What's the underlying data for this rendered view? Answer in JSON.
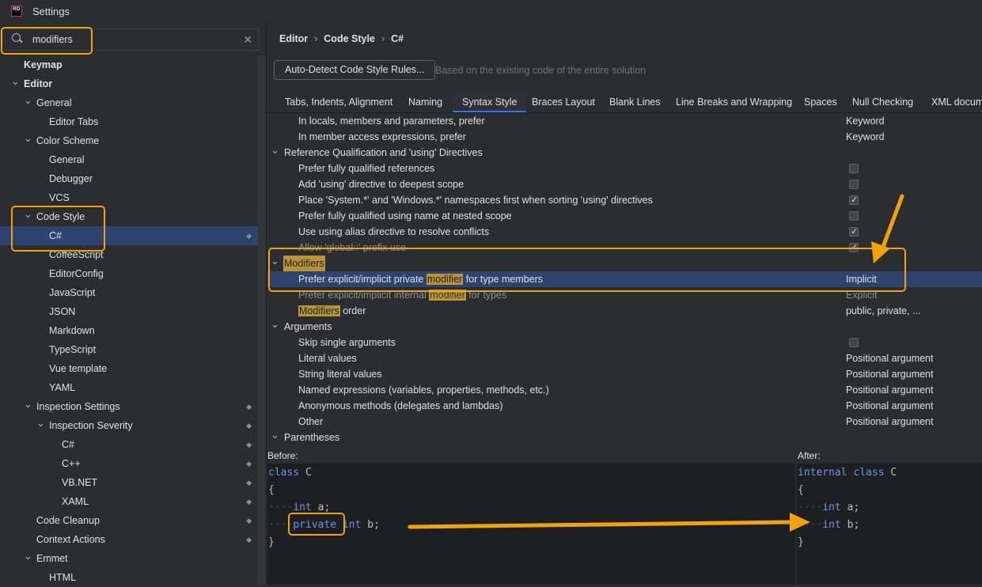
{
  "app": {
    "logo": "RD",
    "title": "Settings"
  },
  "search": {
    "value": "modifiers",
    "placeholder": ""
  },
  "tree": [
    {
      "label": "Keymap",
      "level": 0,
      "bold": true,
      "chev": ""
    },
    {
      "label": "Editor",
      "level": 0,
      "bold": true,
      "chev": "v"
    },
    {
      "label": "General",
      "level": 1,
      "chev": "v"
    },
    {
      "label": "Editor Tabs",
      "level": 2,
      "chev": ""
    },
    {
      "label": "Color Scheme",
      "level": 1,
      "chev": "v"
    },
    {
      "label": "General",
      "level": 2,
      "chev": ""
    },
    {
      "label": "Debugger",
      "level": 2,
      "chev": ""
    },
    {
      "label": "VCS",
      "level": 2,
      "chev": ""
    },
    {
      "label": "Code Style",
      "level": 1,
      "chev": "v"
    },
    {
      "label": "C#",
      "level": 2,
      "chev": "",
      "selected": true,
      "sc": true
    },
    {
      "label": "CoffeeScript",
      "level": 2,
      "chev": ""
    },
    {
      "label": "EditorConfig",
      "level": 2,
      "chev": ""
    },
    {
      "label": "JavaScript",
      "level": 2,
      "chev": ""
    },
    {
      "label": "JSON",
      "level": 2,
      "chev": ""
    },
    {
      "label": "Markdown",
      "level": 2,
      "chev": ""
    },
    {
      "label": "TypeScript",
      "level": 2,
      "chev": ""
    },
    {
      "label": "Vue template",
      "level": 2,
      "chev": ""
    },
    {
      "label": "YAML",
      "level": 2,
      "chev": ""
    },
    {
      "label": "Inspection Settings",
      "level": 1,
      "chev": "v",
      "sc": true
    },
    {
      "label": "Inspection Severity",
      "level": 2,
      "chev": "v",
      "sc": true
    },
    {
      "label": "C#",
      "level": 3,
      "chev": "",
      "sc": true
    },
    {
      "label": "C++",
      "level": 3,
      "chev": "",
      "sc": true
    },
    {
      "label": "VB.NET",
      "level": 3,
      "chev": "",
      "sc": true
    },
    {
      "label": "XAML",
      "level": 3,
      "chev": "",
      "sc": true
    },
    {
      "label": "Code Cleanup",
      "level": 1,
      "chev": "",
      "sc": true
    },
    {
      "label": "Context Actions",
      "level": 1,
      "chev": "",
      "sc": true
    },
    {
      "label": "Emmet",
      "level": 1,
      "chev": "v"
    },
    {
      "label": "HTML",
      "level": 2,
      "chev": ""
    }
  ],
  "breadcrumb": [
    "Editor",
    "Code Style",
    "C#"
  ],
  "auto_detect": {
    "button": "Auto-Detect Code Style Rules...",
    "hint": "Based on the existing code of the entire solution"
  },
  "tabs": [
    "Tabs, Indents, Alignment",
    "Naming",
    "Syntax Style",
    "Braces Layout",
    "Blank Lines",
    "Line Breaks and Wrapping",
    "Spaces",
    "Null Checking",
    "XML docum"
  ],
  "active_tab": "Syntax Style",
  "rows": [
    {
      "type": "item",
      "label": "In locals, members and parameters, prefer",
      "value": "Keyword"
    },
    {
      "type": "item",
      "label": "In member access expressions, prefer",
      "value": "Keyword"
    },
    {
      "type": "group",
      "label": "Reference Qualification and 'using' Directives"
    },
    {
      "type": "item",
      "label": "Prefer fully qualified references",
      "checkbox": false
    },
    {
      "type": "item",
      "label": "Add 'using' directive to deepest scope",
      "checkbox": false
    },
    {
      "type": "item",
      "label": "Place 'System.*' and 'Windows.*' namespaces first when sorting 'using' directives",
      "checkbox": true
    },
    {
      "type": "item",
      "label": "Prefer fully qualified using name at nested scope",
      "checkbox": false
    },
    {
      "type": "item",
      "label": "Use using alias directive to resolve conflicts",
      "checkbox": true
    },
    {
      "type": "item",
      "label": "Allow 'global::' prefix use",
      "checkbox": true,
      "dim": true
    },
    {
      "type": "group",
      "label": "Modifiers",
      "highlight": true
    },
    {
      "type": "item",
      "pre": "Prefer explicit/implicit private ",
      "hl": "modifier",
      "post": " for type members",
      "value": "Implicit",
      "selected": true
    },
    {
      "type": "item",
      "pre": "Prefer explicit/implicit internal ",
      "hl": "modifier",
      "post": " for types",
      "value": "Explicit",
      "dim": true
    },
    {
      "type": "item",
      "pre": "",
      "hl": "Modifiers",
      "post": " order",
      "value": "public, private, ..."
    },
    {
      "type": "group",
      "label": "Arguments"
    },
    {
      "type": "item",
      "label": "Skip single arguments",
      "checkbox": false
    },
    {
      "type": "item",
      "label": "Literal values",
      "value": "Positional argument"
    },
    {
      "type": "item",
      "label": "String literal values",
      "value": "Positional argument"
    },
    {
      "type": "item",
      "label": "Named expressions (variables, properties, methods, etc.)",
      "value": "Positional argument"
    },
    {
      "type": "item",
      "label": "Anonymous methods (delegates and lambdas)",
      "value": "Positional argument"
    },
    {
      "type": "item",
      "label": "Other",
      "value": "Positional argument"
    },
    {
      "type": "group",
      "label": "Parentheses"
    }
  ],
  "preview": {
    "before_label": "Before:",
    "after_label": "After:",
    "before_code": [
      [
        {
          "t": "class",
          "k": true
        },
        {
          "t": " C"
        }
      ],
      [
        {
          "t": "{"
        }
      ],
      [
        {
          "t": "····",
          "d": true
        },
        {
          "t": "int",
          "k": true
        },
        {
          "t": " a;"
        }
      ],
      [
        {
          "t": "····",
          "d": true
        },
        {
          "t": "private",
          "k": true
        },
        {
          "t": " "
        },
        {
          "t": "int",
          "k": true
        },
        {
          "t": " b;"
        }
      ],
      [
        {
          "t": "}"
        }
      ]
    ],
    "after_code": [
      [
        {
          "t": "internal",
          "k": true
        },
        {
          "t": " "
        },
        {
          "t": "class",
          "k": true
        },
        {
          "t": " C"
        }
      ],
      [
        {
          "t": "{"
        }
      ],
      [
        {
          "t": "····",
          "d": true
        },
        {
          "t": "int",
          "k": true
        },
        {
          "t": " a;"
        }
      ],
      [
        {
          "t": "····",
          "d": true
        },
        {
          "t": "int",
          "k": true
        },
        {
          "t": " b;"
        }
      ],
      [
        {
          "t": "}"
        }
      ]
    ]
  },
  "colors": {
    "accent": "#3574f0",
    "selection": "#2e436e",
    "annotation": "#f0a30a",
    "keyword": "#6c95eb",
    "search_highlight": "#b89437"
  }
}
